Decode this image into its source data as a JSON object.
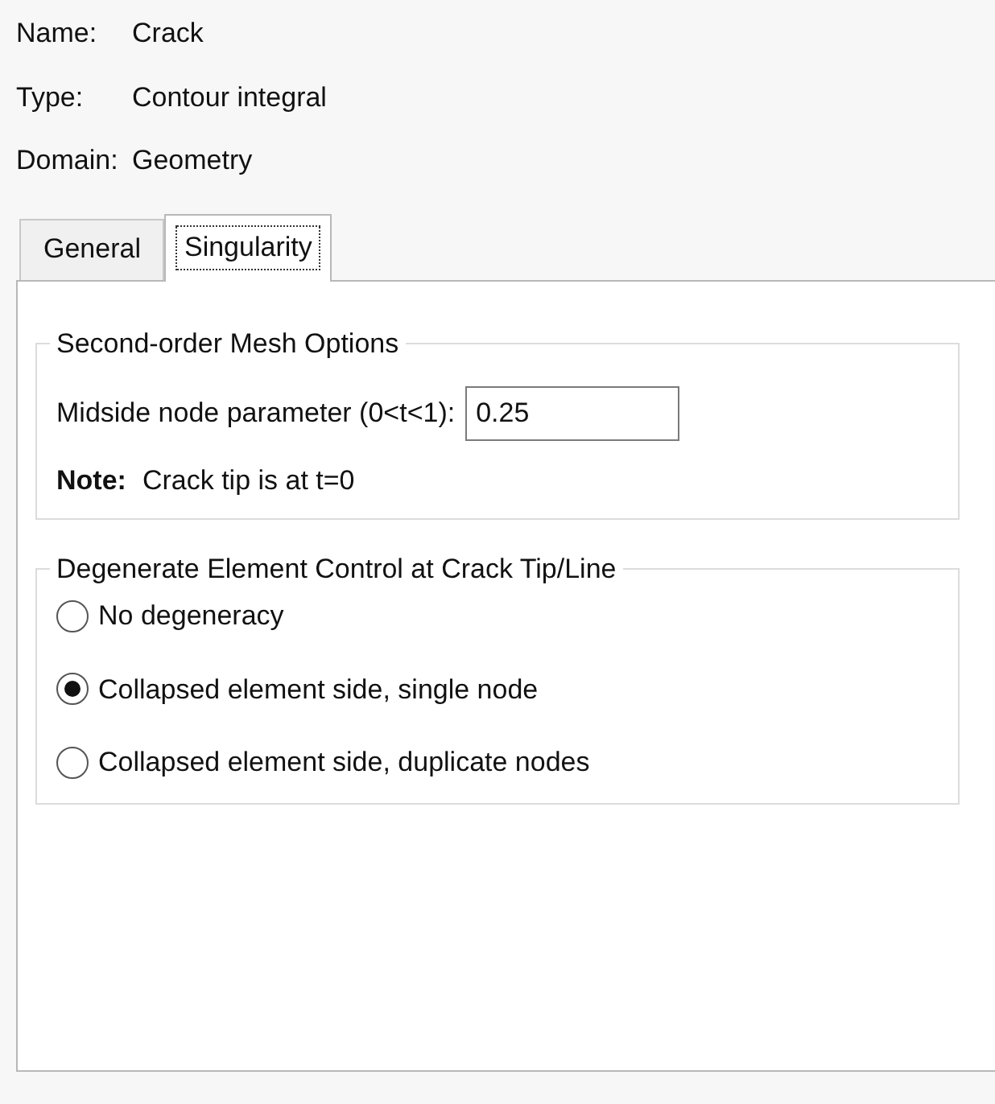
{
  "info": [
    {
      "label": "Name:",
      "value": "Crack"
    },
    {
      "label": "Type:",
      "value": "Contour integral"
    },
    {
      "label": "Domain:",
      "value": "Geometry"
    }
  ],
  "tabs": [
    {
      "label": "General",
      "selected": false
    },
    {
      "label": "Singularity",
      "selected": true
    }
  ],
  "mesh_options": {
    "title": "Second-order Mesh Options",
    "field_label": "Midside node parameter (0<t<1):",
    "field_value": "0.25",
    "note_label": "Note:",
    "note_text": "Crack tip is at t=0"
  },
  "degenerate_control": {
    "title": "Degenerate Element Control at Crack Tip/Line",
    "options": [
      {
        "label": "No degeneracy",
        "selected": false
      },
      {
        "label": "Collapsed element side, single node",
        "selected": true
      },
      {
        "label": "Collapsed element side, duplicate nodes",
        "selected": false
      }
    ]
  }
}
